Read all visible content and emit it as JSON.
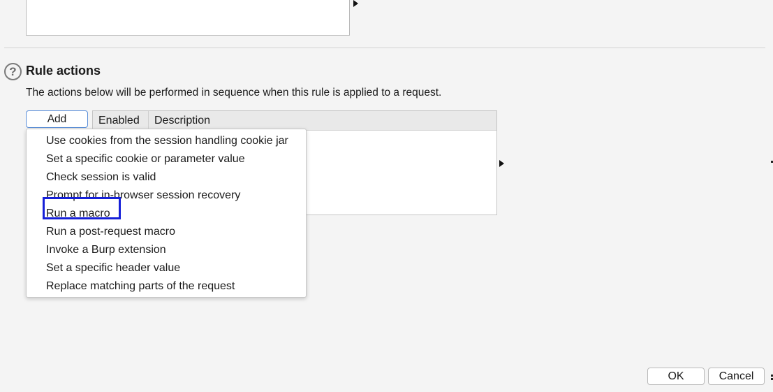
{
  "rule_actions": {
    "title": "Rule actions",
    "help_icon_glyph": "?",
    "description": "The actions below will be performed in sequence when this rule is applied to a request.",
    "add_label": "Add",
    "table_headers": [
      "Enabled",
      "Description"
    ]
  },
  "add_menu": {
    "items": [
      "Use cookies from the session handling cookie jar",
      "Set a specific cookie or parameter value",
      "Check session is valid",
      "Prompt for in-browser session recovery",
      "Run a macro",
      "Run a post-request macro",
      "Invoke a Burp extension",
      "Set a specific header value",
      "Replace matching parts of the request"
    ],
    "highlighted_item": "Run a macro",
    "highlight_color": "#1620d8"
  },
  "footer": {
    "ok_label": "OK",
    "cancel_label": "Cancel"
  }
}
